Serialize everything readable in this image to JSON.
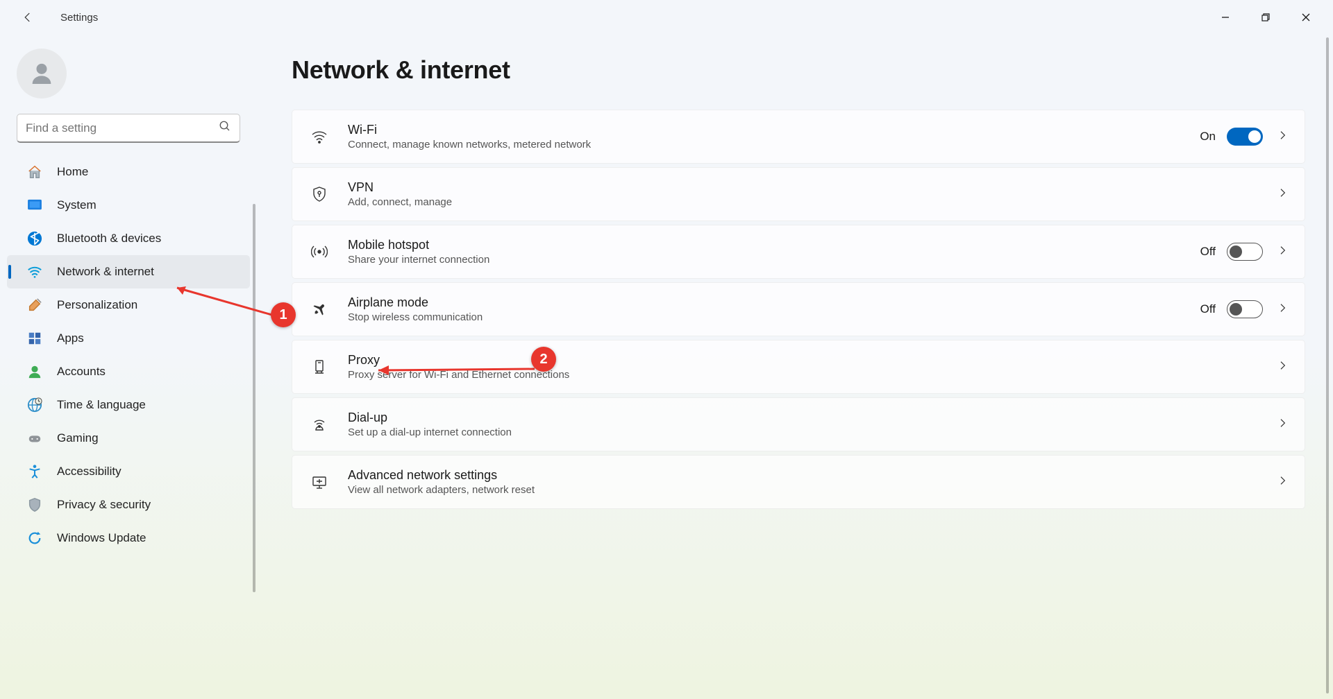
{
  "title": "Settings",
  "search": {
    "placeholder": "Find a setting"
  },
  "sidebar": {
    "items": [
      {
        "label": "Home",
        "icon": "home"
      },
      {
        "label": "System",
        "icon": "system"
      },
      {
        "label": "Bluetooth & devices",
        "icon": "bluetooth"
      },
      {
        "label": "Network & internet",
        "icon": "wifi",
        "selected": true
      },
      {
        "label": "Personalization",
        "icon": "brush"
      },
      {
        "label": "Apps",
        "icon": "apps"
      },
      {
        "label": "Accounts",
        "icon": "person"
      },
      {
        "label": "Time & language",
        "icon": "globe"
      },
      {
        "label": "Gaming",
        "icon": "gamepad"
      },
      {
        "label": "Accessibility",
        "icon": "accessibility"
      },
      {
        "label": "Privacy & security",
        "icon": "shield"
      },
      {
        "label": "Windows Update",
        "icon": "update"
      }
    ]
  },
  "page": {
    "heading": "Network & internet",
    "cards": [
      {
        "icon": "wifi",
        "title": "Wi-Fi",
        "sub": "Connect, manage known networks, metered network",
        "status": "On",
        "toggle": "on"
      },
      {
        "icon": "vpn",
        "title": "VPN",
        "sub": "Add, connect, manage"
      },
      {
        "icon": "hotspot",
        "title": "Mobile hotspot",
        "sub": "Share your internet connection",
        "status": "Off",
        "toggle": "off"
      },
      {
        "icon": "airplane",
        "title": "Airplane mode",
        "sub": "Stop wireless communication",
        "status": "Off",
        "toggle": "off"
      },
      {
        "icon": "proxy",
        "title": "Proxy",
        "sub": "Proxy server for Wi-Fi and Ethernet connections"
      },
      {
        "icon": "dialup",
        "title": "Dial-up",
        "sub": "Set up a dial-up internet connection"
      },
      {
        "icon": "advanced",
        "title": "Advanced network settings",
        "sub": "View all network adapters, network reset"
      }
    ]
  },
  "annotations": {
    "1": "1",
    "2": "2"
  }
}
